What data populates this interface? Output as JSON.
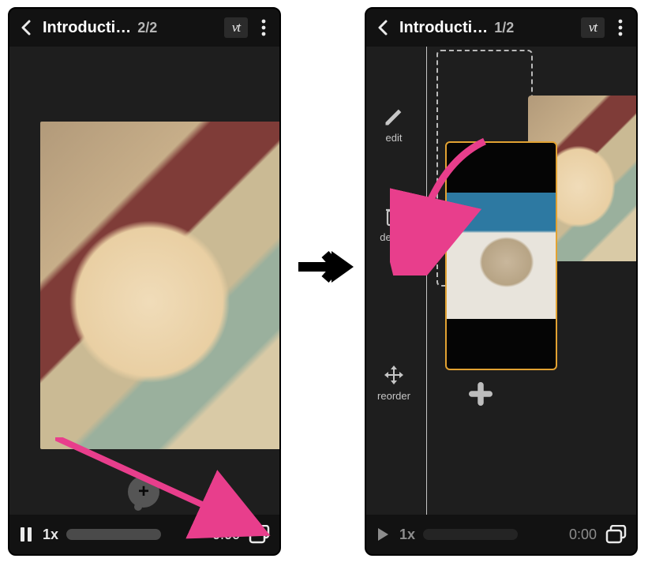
{
  "left": {
    "header": {
      "title": "Introducti…",
      "counter": "2/2",
      "logo": "vt"
    },
    "footer": {
      "speed": "1x",
      "time": "0:00",
      "playing": true
    },
    "icons": {
      "back": "back-chevron",
      "more": "more-dots",
      "comment_plus": "+",
      "layers": "layers-icon",
      "pause": "pause-icon"
    }
  },
  "right": {
    "header": {
      "title": "Introducti…",
      "counter": "1/2",
      "logo": "vt"
    },
    "tools": {
      "edit": "edit",
      "delete": "delete",
      "reorder": "reorder"
    },
    "footer": {
      "speed": "1x",
      "time": "0:00",
      "playing": false
    },
    "icons": {
      "back": "back-chevron",
      "more": "more-dots",
      "plus": "plus-icon",
      "layers": "layers-icon",
      "play": "play-icon",
      "edit_icon": "pencil-icon",
      "delete_icon": "trash-icon",
      "reorder_icon": "move-icon"
    }
  },
  "colors": {
    "accent_pink": "#e83e8c",
    "selection_orange": "#e2a232",
    "bg": "#121212"
  }
}
